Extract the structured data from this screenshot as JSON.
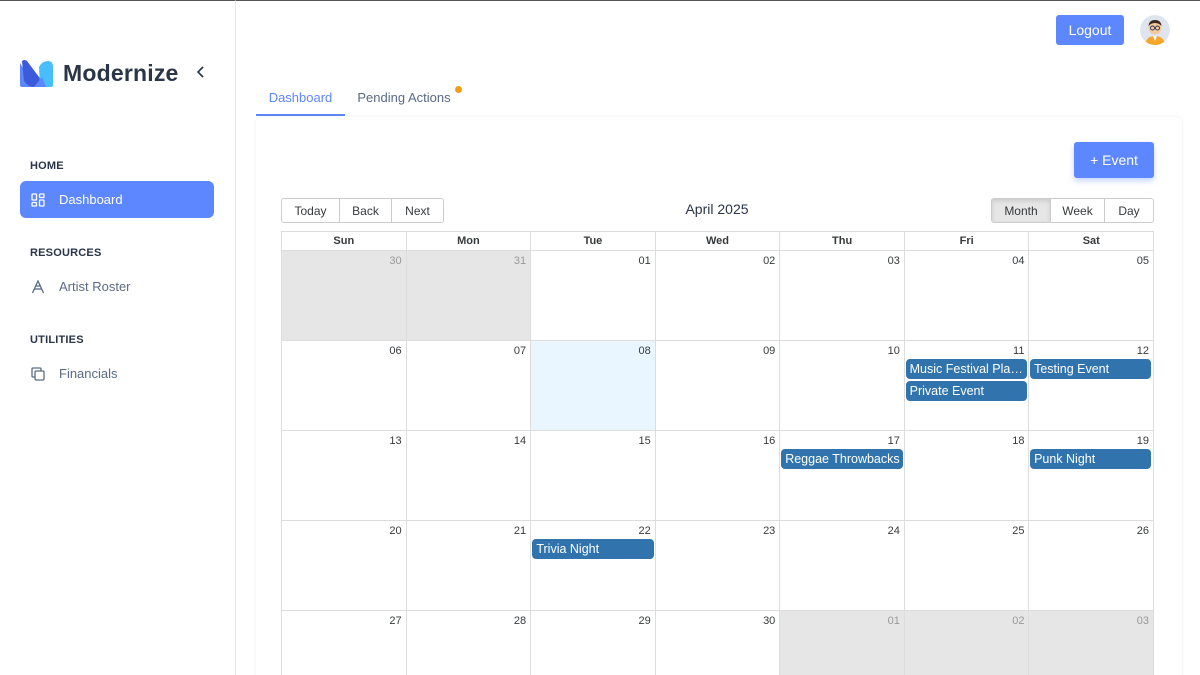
{
  "sidebar": {
    "brand": "Modernize",
    "sections": [
      {
        "title": "HOME",
        "items": [
          {
            "label": "Dashboard",
            "icon": "dashboard-icon",
            "active": true
          }
        ]
      },
      {
        "title": "RESOURCES",
        "items": [
          {
            "label": "Artist Roster",
            "icon": "artist-a-icon"
          }
        ]
      },
      {
        "title": "UTILITIES",
        "items": [
          {
            "label": "Financials",
            "icon": "copy-icon"
          }
        ]
      }
    ]
  },
  "header": {
    "logout_label": "Logout"
  },
  "tabs": [
    {
      "label": "Dashboard"
    },
    {
      "label": "Pending Actions"
    }
  ],
  "toolbar": {
    "add_event_label": "+ Event",
    "nav": [
      "Today",
      "Back",
      "Next"
    ],
    "label": "April 2025",
    "views": [
      "Month",
      "Week",
      "Day"
    ],
    "active_view": "Month"
  },
  "calendar": {
    "weekdays": [
      "Sun",
      "Mon",
      "Tue",
      "Wed",
      "Thu",
      "Fri",
      "Sat"
    ],
    "weeks": [
      [
        "30",
        "31",
        "01",
        "02",
        "03",
        "04",
        "05"
      ],
      [
        "06",
        "07",
        "08",
        "09",
        "10",
        "11",
        "12"
      ],
      [
        "13",
        "14",
        "15",
        "16",
        "17",
        "18",
        "19"
      ],
      [
        "20",
        "21",
        "22",
        "23",
        "24",
        "25",
        "26"
      ],
      [
        "27",
        "28",
        "29",
        "30",
        "01",
        "02",
        "03"
      ]
    ],
    "events": [
      {
        "title": "Music Festival Planning",
        "week": 1,
        "day": 5,
        "slot": 0
      },
      {
        "title": "Private Event",
        "week": 1,
        "day": 5,
        "slot": 1
      },
      {
        "title": "Testing Event",
        "week": 1,
        "day": 6,
        "slot": 0
      },
      {
        "title": "Reggae Throwbacks",
        "week": 2,
        "day": 4,
        "slot": 0
      },
      {
        "title": "Punk Night",
        "week": 2,
        "day": 6,
        "slot": 0
      },
      {
        "title": "Trivia Night",
        "week": 3,
        "day": 2,
        "slot": 0
      }
    ],
    "colors": {
      "event": "#3174ad",
      "today": "#eaf6ff",
      "off_range": "#e6e6e6",
      "accent": "#5d87ff"
    }
  }
}
